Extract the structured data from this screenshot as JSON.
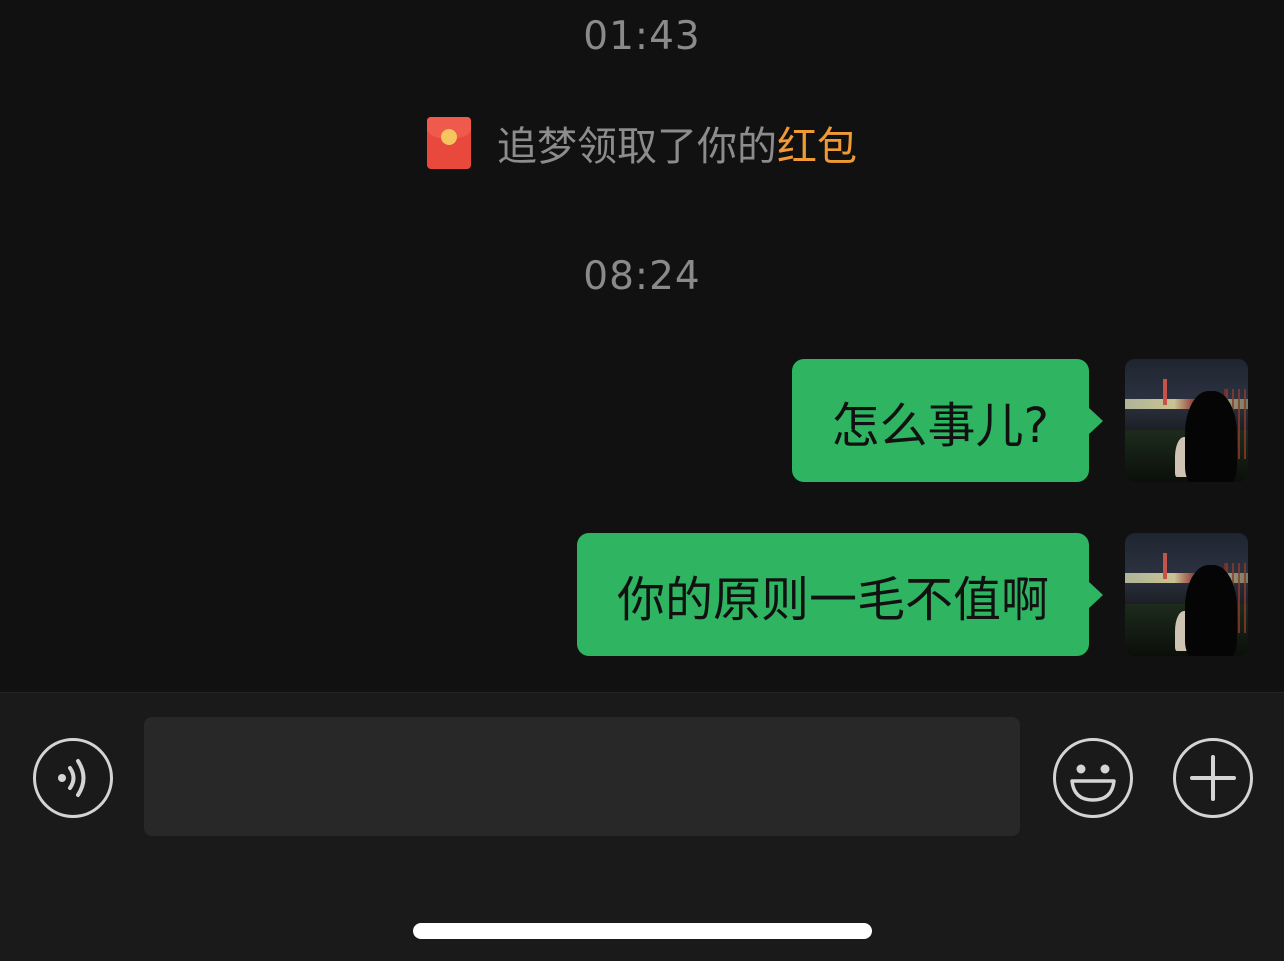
{
  "chat": {
    "timestamps": [
      "01:43",
      "08:24"
    ],
    "system_message": {
      "icon": "red-packet-icon",
      "text": "追梦领取了你的",
      "link": "红包"
    },
    "messages": [
      {
        "side": "right",
        "text": "怎么事儿?"
      },
      {
        "side": "right",
        "text": "你的原则一毛不值啊"
      }
    ]
  },
  "input_bar": {
    "voice_icon": "voice-icon",
    "input_value": "",
    "emoji_icon": "emoji-icon",
    "plus_icon": "plus-icon"
  },
  "colors": {
    "background": "#111111",
    "bubble": "#2fb562",
    "link_orange": "#f09a36",
    "red_packet": "#e9483c"
  }
}
